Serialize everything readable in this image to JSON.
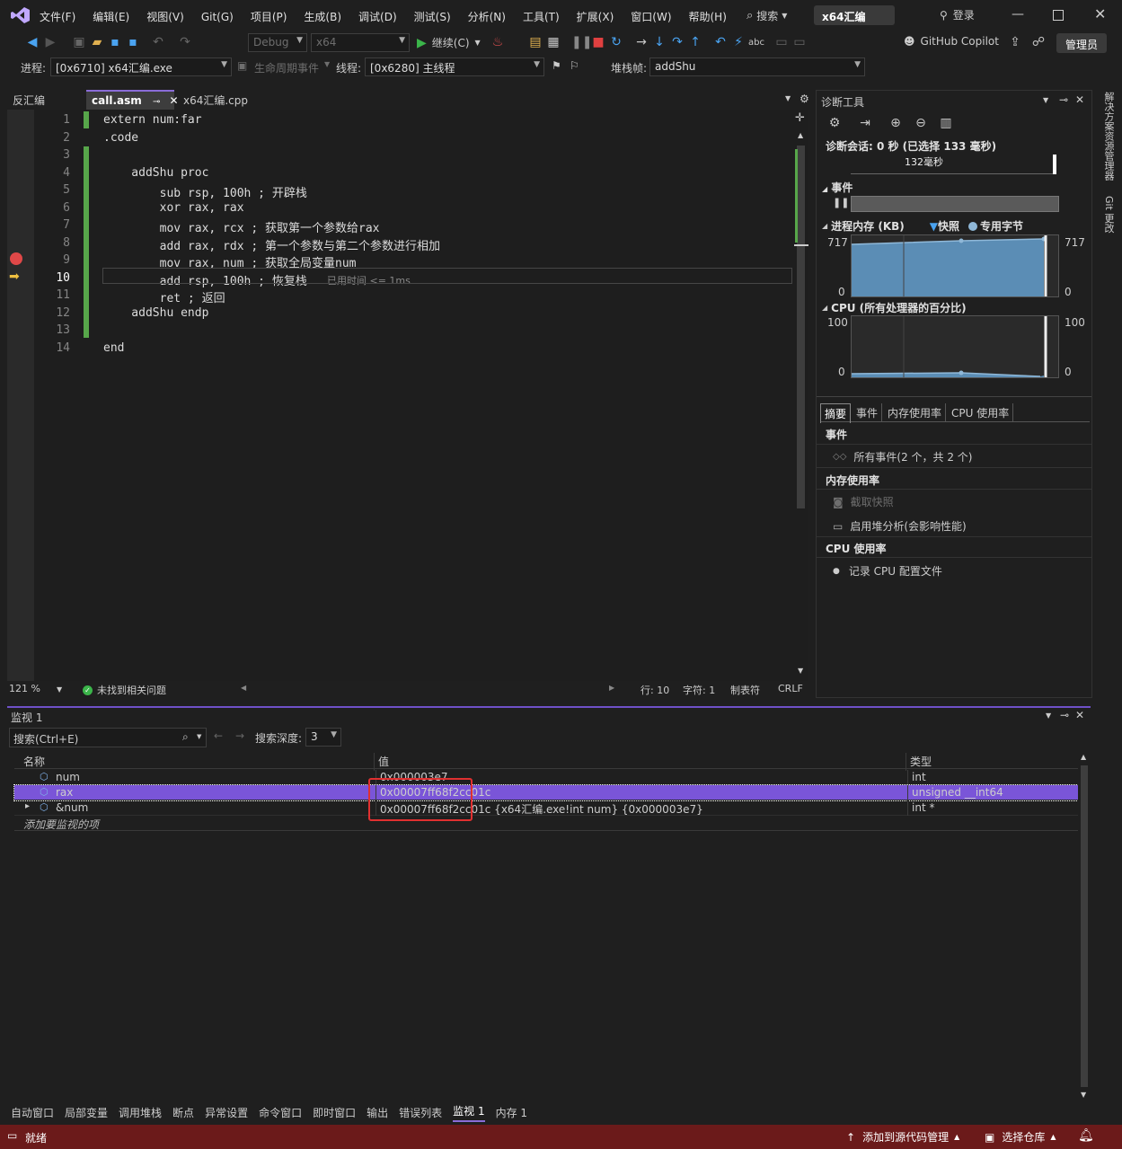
{
  "menu": {
    "items": [
      "文件(F)",
      "编辑(E)",
      "视图(V)",
      "Git(G)",
      "项目(P)",
      "生成(B)",
      "调试(D)",
      "测试(S)",
      "分析(N)",
      "工具(T)",
      "扩展(X)",
      "窗口(W)",
      "帮助(H)"
    ],
    "search": "搜索",
    "project_badge": "x64汇编",
    "login": "登录"
  },
  "toolbar": {
    "config": "Debug",
    "platform": "x64",
    "continue_label": "继续(C)",
    "copilot_label": "GitHub Copilot",
    "admin_label": "管理员"
  },
  "toolbar2": {
    "process_label": "进程:",
    "process_value": "[0x6710] x64汇编.exe",
    "lifecycle_label": "生命周期事件",
    "thread_label": "线程:",
    "thread_value": "[0x6280] 主线程",
    "stackframe_label": "堆栈帧:",
    "stackframe_value": "addShu"
  },
  "editor_tabs": [
    {
      "label": "反汇编"
    },
    {
      "label": "call.asm"
    },
    {
      "label": "x64汇编.cpp"
    }
  ],
  "code": {
    "lines": [
      {
        "num": "1",
        "text": "extern num:far"
      },
      {
        "num": "2",
        "text": ".code"
      },
      {
        "num": "3",
        "text": ""
      },
      {
        "num": "4",
        "text": "    addShu proc"
      },
      {
        "num": "5",
        "text": "        sub rsp, 100h ; 开辟栈"
      },
      {
        "num": "6",
        "text": "        xor rax, rax"
      },
      {
        "num": "7",
        "text": "        mov rax, rcx ; 获取第一个参数给rax"
      },
      {
        "num": "8",
        "text": "        add rax, rdx ; 第一个参数与第二个参数进行相加"
      },
      {
        "num": "9",
        "text": "        mov rax, num ; 获取全局变量num"
      },
      {
        "num": "10",
        "text": "        add rsp, 100h ; 恢复栈"
      },
      {
        "num": "11",
        "text": "        ret ; 返回"
      },
      {
        "num": "12",
        "text": "    addShu endp"
      },
      {
        "num": "13",
        "text": ""
      },
      {
        "num": "14",
        "text": "end"
      }
    ],
    "elapsed_hint": "已用时间 <= 1ms",
    "current_line": 10,
    "breakpoint_line": 9
  },
  "editor_status": {
    "zoom": "121 %",
    "issues": "未找到相关问题",
    "line": "行: 10",
    "char": "字符: 1",
    "tabs": "制表符",
    "eol": "CRLF"
  },
  "diag": {
    "title": "诊断工具",
    "session": "诊断会话: 0 秒 (已选择 133 毫秒)",
    "timeline_label": "132毫秒",
    "events_header": "事件",
    "mem_header": "进程内存 (KB)",
    "legend_snapshot": "快照",
    "legend_private": "专用字节",
    "mem_max": "717",
    "mem_min": "0",
    "cpu_header": "CPU (所有处理器的百分比)",
    "cpu_max": "100",
    "cpu_min": "0",
    "tabs": [
      "摘要",
      "事件",
      "内存使用率",
      "CPU 使用率"
    ],
    "summary": {
      "events_title": "事件",
      "all_events": "所有事件(2 个，共 2 个)",
      "memory_title": "内存使用率",
      "snapshot": "截取快照",
      "heap_analysis": "启用堆分析(会影响性能)",
      "cpu_title": "CPU 使用率",
      "record_cpu": "记录 CPU 配置文件"
    },
    "colors": {
      "fill": "#5b8db5",
      "line": "#8fb8d8"
    }
  },
  "right_rail": [
    "解决方案资源管理器",
    "Git 更改"
  ],
  "watch": {
    "title": "监视 1",
    "search_placeholder": "搜索(Ctrl+E)",
    "depth_label": "搜索深度:",
    "depth_value": "3",
    "columns": [
      "名称",
      "值",
      "类型"
    ],
    "rows": [
      {
        "name": "num",
        "value": "0x000003e7",
        "type": "int",
        "selected": false
      },
      {
        "name": "rax",
        "value": "0x00007ff68f2cc01c",
        "type": "unsigned __int64",
        "selected": true
      },
      {
        "name": "&num",
        "value": "0x00007ff68f2cc01c {x64汇编.exe!int num} {0x000003e7}",
        "type": "int *",
        "selected": false
      }
    ],
    "add_item": "添加要监视的项"
  },
  "bottom_tabs": [
    "自动窗口",
    "局部变量",
    "调用堆栈",
    "断点",
    "异常设置",
    "命令窗口",
    "即时窗口",
    "输出",
    "错误列表",
    "监视 1",
    "内存 1"
  ],
  "status": {
    "ready": "就绪",
    "add_source": "添加到源代码管理",
    "select_repo": "选择仓库"
  }
}
